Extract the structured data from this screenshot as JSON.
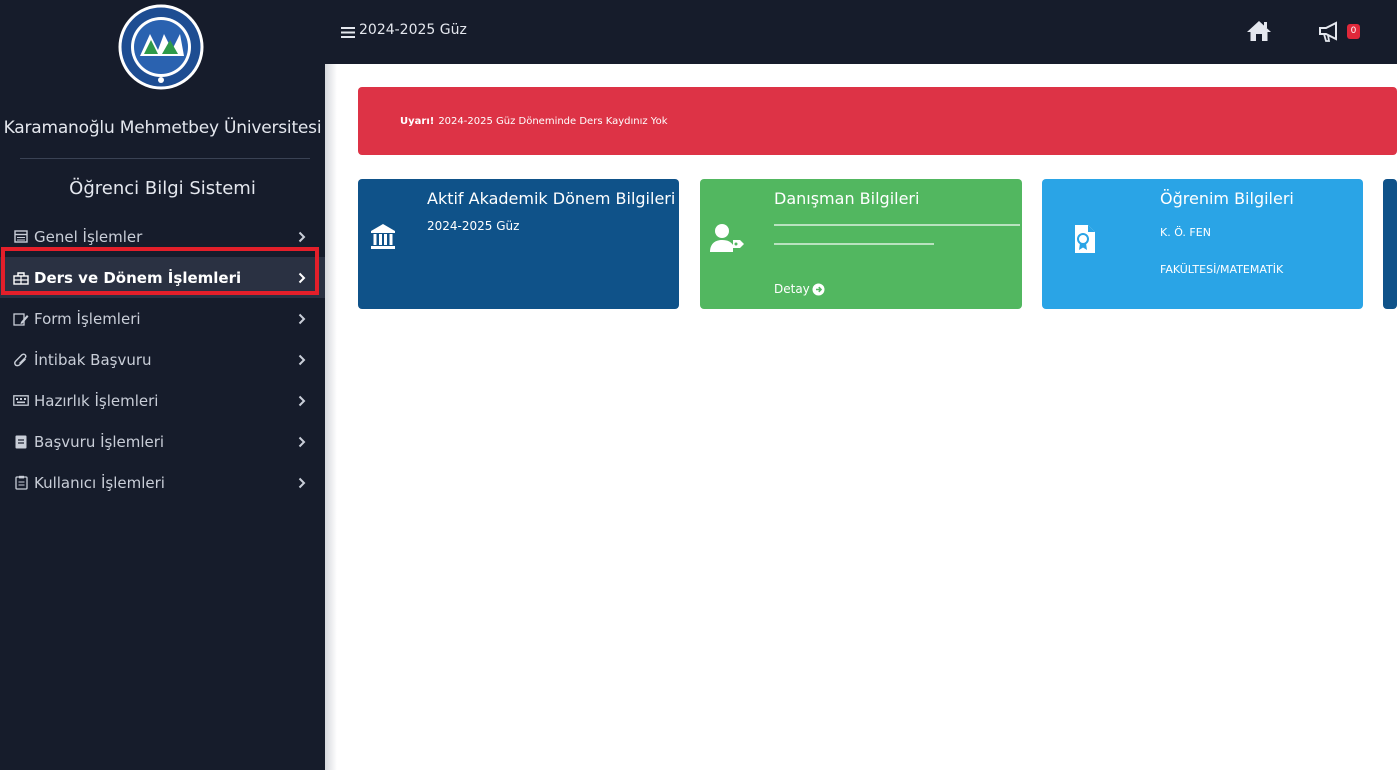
{
  "sidebar": {
    "university": "Karamanoğlu Mehmetbey Üniversitesi",
    "system_title": "Öğrenci Bilgi Sistemi",
    "items": [
      {
        "label": "Genel İşlemler",
        "icon": "calendar-icon"
      },
      {
        "label": "Ders ve Dönem İşlemleri",
        "icon": "building-icon",
        "active": true
      },
      {
        "label": "Form İşlemleri",
        "icon": "form-edit-icon"
      },
      {
        "label": "İntibak Başvuru",
        "icon": "paperclip-icon"
      },
      {
        "label": "Hazırlık İşlemleri",
        "icon": "keyboard-icon"
      },
      {
        "label": "Başvuru İşlemleri",
        "icon": "document-icon"
      },
      {
        "label": "Kullanıcı İşlemleri",
        "icon": "clipboard-icon"
      }
    ]
  },
  "topbar": {
    "term": "2024-2025 Güz",
    "notification_count": "0"
  },
  "alert": {
    "prefix": "Uyarı!",
    "message": "2024-2025 Güz Döneminde Ders Kaydınız Yok"
  },
  "cards": {
    "academic": {
      "title": "Aktif Akademik Dönem Bilgileri",
      "value": "2024-2025 Güz"
    },
    "advisor": {
      "title": "Danışman Bilgileri",
      "detail_link": "Detay"
    },
    "education": {
      "title": "Öğrenim Bilgileri",
      "line1": "K. Ö. FEN",
      "line2": "FAKÜLTESİ/MATEMATİK"
    }
  },
  "colors": {
    "sidebar_bg": "#161c2b",
    "alert_bg": "#dd3346",
    "card_blue": "#0f5289",
    "card_green": "#52b760",
    "card_cyan": "#2aa4e6",
    "highlight": "#e41f2a"
  }
}
